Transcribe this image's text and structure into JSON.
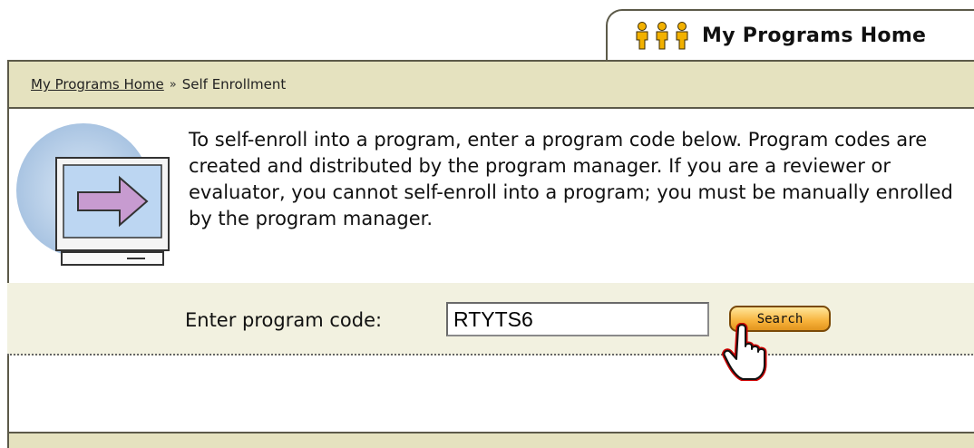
{
  "tab": {
    "label": "My Programs Home",
    "icon": "people-icon"
  },
  "breadcrumb": {
    "home_link": "My Programs Home",
    "separator": "»",
    "current": "Self Enrollment"
  },
  "content": {
    "description": "To self-enroll into a program, enter a program code below. Program codes are created and distributed by the program manager. If you are a reviewer or evaluator, you cannot self-enroll into a program; you must be manually enrolled by the program manager.",
    "graphic_icon": "monitor-arrow-icon"
  },
  "form": {
    "code_label": "Enter program code:",
    "code_value": "RTYTS6",
    "search_label": "Search"
  },
  "colors": {
    "panel_bg": "#e5e2bf",
    "border": "#5c5a49",
    "button": "#f7b23b"
  }
}
